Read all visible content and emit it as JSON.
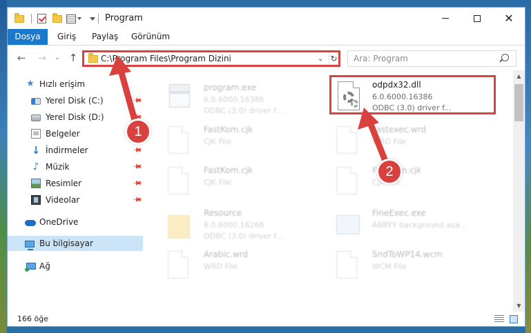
{
  "window": {
    "title": "Program",
    "minimize_glyph": "",
    "close_glyph": "✕"
  },
  "ribbon": {
    "tabs": [
      {
        "label": "Dosya"
      },
      {
        "label": "Giriş"
      },
      {
        "label": "Paylaş"
      },
      {
        "label": "Görünüm"
      }
    ]
  },
  "navigation": {
    "back_glyph": "←",
    "forward_glyph": "→",
    "recent_glyph": "⌄",
    "up_glyph": "↑",
    "address": "C:\\Program Files\\Program Dizini",
    "address_dropdown_glyph": "⌄",
    "refresh_glyph": "↻",
    "search_placeholder": "Ara: Program"
  },
  "sidebar": {
    "items": [
      {
        "label": "Hızlı erişim",
        "icon": "star-icon"
      },
      {
        "label": "Yerel Disk (C:)",
        "icon": "drive-icon"
      },
      {
        "label": "Yerel Disk (D:)",
        "icon": "drive-icon"
      },
      {
        "label": "Belgeler",
        "icon": "documents-icon"
      },
      {
        "label": "İndirmeler",
        "icon": "download-icon"
      },
      {
        "label": "Müzik",
        "icon": "music-icon"
      },
      {
        "label": "Resimler",
        "icon": "pictures-icon"
      },
      {
        "label": "Videolar",
        "icon": "video-icon"
      },
      {
        "label": "OneDrive",
        "icon": "cloud-icon"
      },
      {
        "label": "Bu bilgisayar",
        "icon": "computer-icon"
      },
      {
        "label": "Ağ",
        "icon": "network-icon"
      }
    ],
    "pin_glyph": "📌"
  },
  "files": [
    {
      "name": "program.exe",
      "line1": "6.0.6000.16386",
      "line2": "ODBC (3.0) driver f...",
      "icon": "exe-icon"
    },
    {
      "name": "odpdx32.dll",
      "line1": "6.0.6000.16386",
      "line2": "ODBC (3.0) driver f...",
      "icon": "dll-gear-icon"
    },
    {
      "name": "FastKom.cjk",
      "line1": "CJK File",
      "line2": "",
      "icon": "document-icon"
    },
    {
      "name": "Fastexec.wrd",
      "line1": "WRD File",
      "line2": "",
      "icon": "document-icon"
    },
    {
      "name": "FastKom.cjk",
      "line1": "CJK File",
      "line2": "",
      "icon": "document-icon"
    },
    {
      "name": "FastKom.cjk",
      "line1": "CJK File",
      "line2": "",
      "icon": "document-icon"
    },
    {
      "name": "Resource",
      "line1": "6.0.6000.16266",
      "line2": "ODBC (3.0) driver f...",
      "icon": "folder-icon"
    },
    {
      "name": "FineExec.exe",
      "line1": "ABBYY background asa...",
      "line2": "",
      "icon": "application-icon"
    },
    {
      "name": "Arabic.wrd",
      "line1": "WRD File",
      "line2": "",
      "icon": "document-icon"
    },
    {
      "name": "SndToWP14.wcm",
      "line1": "WCM File",
      "line2": "",
      "icon": "document-icon"
    }
  ],
  "status": {
    "count": "166 öğe"
  },
  "annotations": {
    "badge_1": "1",
    "badge_2": "2",
    "color": "#d9413f"
  }
}
